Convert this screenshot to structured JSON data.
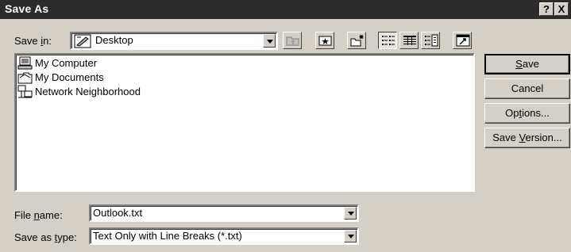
{
  "window": {
    "title": "Save As",
    "help_label": "?",
    "close_label": "X"
  },
  "save_in": {
    "label_pre": "Save ",
    "label_key": "i",
    "label_post": "n:",
    "value": "Desktop"
  },
  "toolbar": {
    "buttons": [
      "up-one-level",
      "look-in-favorites",
      "add-to-favorites",
      "create-new-folder",
      "list-view",
      "details-view",
      "properties-view",
      "commands"
    ]
  },
  "files": [
    {
      "name": "My Computer",
      "icon": "computer-icon"
    },
    {
      "name": "My Documents",
      "icon": "folder-icon"
    },
    {
      "name": "Network Neighborhood",
      "icon": "network-icon"
    }
  ],
  "file_name": {
    "label_pre": "File ",
    "label_key": "n",
    "label_post": "ame:",
    "value": "Outlook.txt"
  },
  "save_type": {
    "label_pre": "Save as ",
    "label_key": "t",
    "label_post": "ype:",
    "value": "Text Only with Line Breaks (*.txt)"
  },
  "buttons": {
    "save_key": "S",
    "save_rest": "ave",
    "cancel": "Cancel",
    "options_pre": "Op",
    "options_key": "t",
    "options_post": "ions...",
    "version_pre": "Save ",
    "version_key": "V",
    "version_post": "ersion..."
  }
}
